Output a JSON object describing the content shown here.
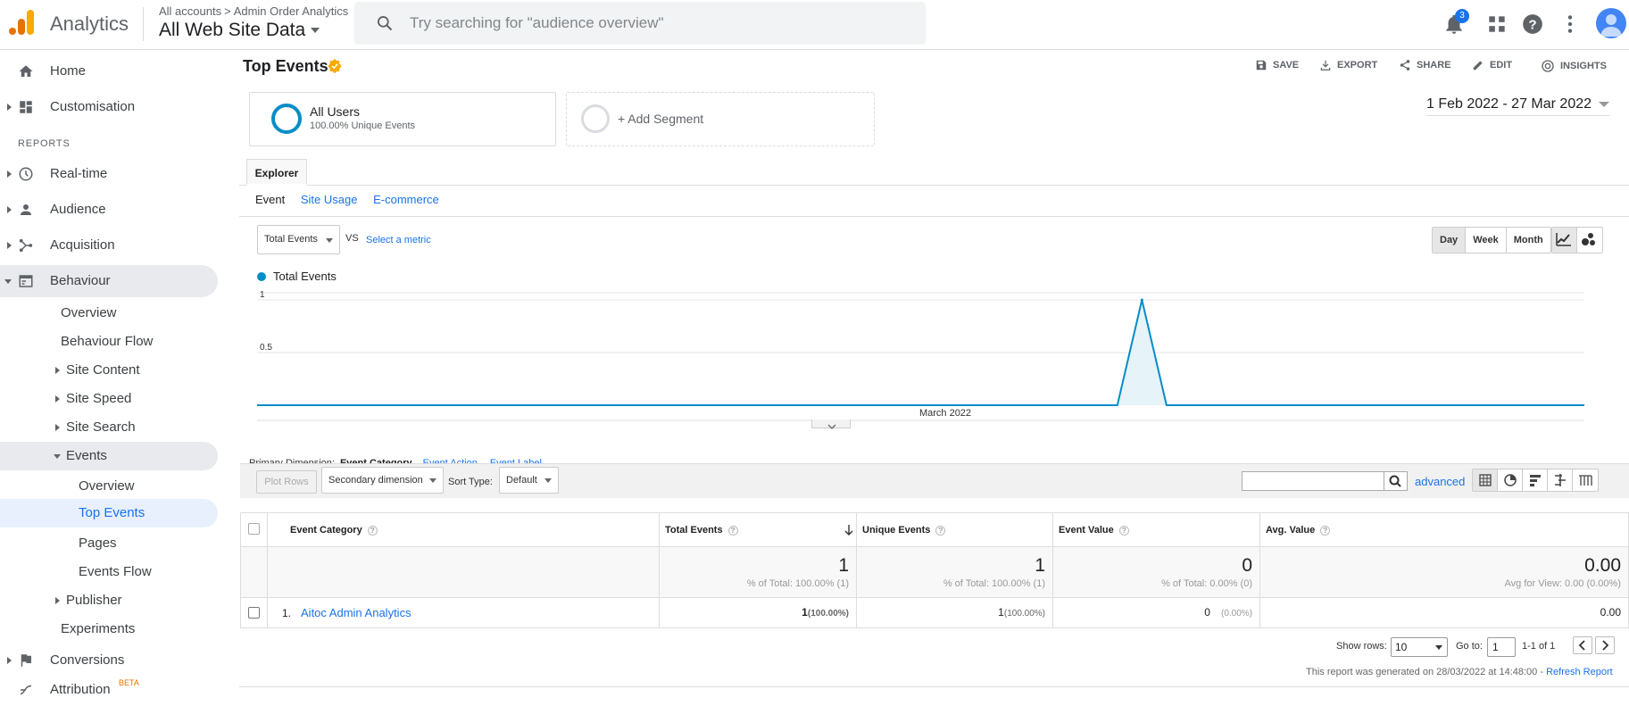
{
  "header": {
    "app_name": "Analytics",
    "breadcrumb_root": "All accounts",
    "breadcrumb_separator": ">",
    "breadcrumb_account": "Admin Order Analytics",
    "view_name": "All Web Site Data",
    "search_placeholder": "Try searching for \"audience overview\"",
    "notification_count": "3",
    "icons": [
      "notifications-icon",
      "apps-icon",
      "help-icon",
      "more-vert-icon",
      "account-icon"
    ]
  },
  "sidebar": {
    "home": "Home",
    "customisation": "Customisation",
    "reports_label": "REPORTS",
    "realtime": "Real-time",
    "audience": "Audience",
    "acquisition": "Acquisition",
    "behaviour": "Behaviour",
    "behaviour_items": {
      "overview": "Overview",
      "behaviour_flow": "Behaviour Flow",
      "site_content": "Site Content",
      "site_speed": "Site Speed",
      "site_search": "Site Search",
      "events": "Events"
    },
    "events_items": {
      "overview": "Overview",
      "top_events": "Top Events",
      "pages": "Pages",
      "events_flow": "Events Flow"
    },
    "publisher": "Publisher",
    "experiments": "Experiments",
    "conversions": "Conversions",
    "attribution": "Attribution",
    "attribution_badge": "BETA"
  },
  "report": {
    "title": "Top Events",
    "actions": {
      "save": "SAVE",
      "export": "EXPORT",
      "share": "SHARE",
      "edit": "EDIT",
      "insights": "INSIGHTS"
    },
    "segment": {
      "name": "All Users",
      "sub": "100.00% Unique Events",
      "add": "+ Add Segment"
    },
    "date_range": "1 Feb 2022 - 27 Mar 2022",
    "explorer_tab": "Explorer",
    "subtabs": [
      "Event",
      "Site Usage",
      "E-commerce"
    ],
    "metric_select": "Total Events",
    "vs": "VS",
    "select_metric": "Select a metric",
    "granularity": [
      "Day",
      "Week",
      "Month"
    ],
    "granularity_selected": "Day"
  },
  "chart_data": {
    "type": "area",
    "series": [
      {
        "name": "Total Events",
        "color": "#058dc7"
      }
    ],
    "y_ticks": [
      "1",
      "0.5"
    ],
    "ylim": [
      0,
      1
    ],
    "x_label": "March 2022",
    "points": [
      {
        "date": "2022-02-01",
        "value": 0
      },
      {
        "date": "2022-03-08",
        "value": 0
      },
      {
        "date": "2022-03-09",
        "value": 1
      },
      {
        "date": "2022-03-10",
        "value": 0
      },
      {
        "date": "2022-03-27",
        "value": 0
      }
    ],
    "grid": true,
    "legend_position": "top-left"
  },
  "table": {
    "primary_dimension_label": "Primary Dimension:",
    "dimensions": [
      "Event Category",
      "Event Action",
      "Event Label"
    ],
    "plot_rows": "Plot Rows",
    "secondary_dimension": "Secondary dimension",
    "sort_type_label": "Sort Type:",
    "sort_type_value": "Default",
    "advanced": "advanced",
    "columns": [
      "Event Category",
      "Total Events",
      "Unique Events",
      "Event Value",
      "Avg. Value"
    ],
    "totals": {
      "total_events": "1",
      "total_events_sub": "% of Total: 100.00% (1)",
      "unique_events": "1",
      "unique_events_sub": "% of Total: 100.00% (1)",
      "event_value": "0",
      "event_value_sub": "% of Total: 0.00% (0)",
      "avg_value": "0.00",
      "avg_value_sub": "Avg for View: 0.00 (0.00%)"
    },
    "rows": [
      {
        "index": "1.",
        "category": "Aitoc Admin Analytics",
        "total_events": "1",
        "total_events_pct": "(100.00%)",
        "unique_events": "1",
        "unique_events_pct": "(100.00%)",
        "event_value": "0",
        "event_value_pct": "(0.00%)",
        "avg_value": "0.00"
      }
    ],
    "show_rows_label": "Show rows:",
    "show_rows_value": "10",
    "goto_label": "Go to:",
    "goto_value": "1",
    "range": "1-1 of 1",
    "generated": "This report was generated on 28/03/2022 at 14:48:00 -",
    "refresh": "Refresh Report"
  }
}
